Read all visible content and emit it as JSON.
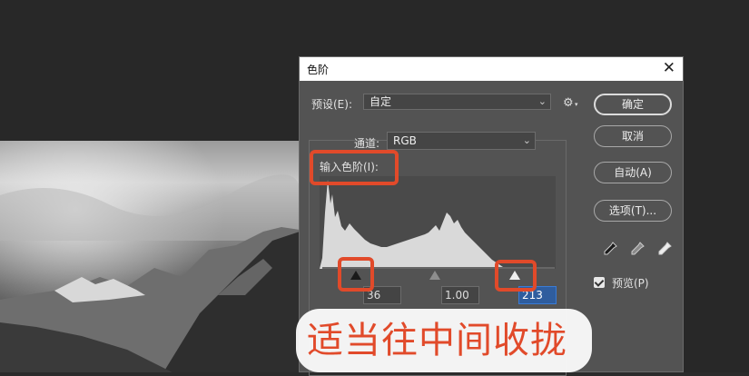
{
  "dialog": {
    "title": "色阶",
    "close_symbol": "✕",
    "preset_label": "预设(E):",
    "preset_value": "自定",
    "channel_label": "通道:",
    "channel_value": "RGB",
    "input_levels_label": "输入色阶(I):",
    "input_black": "36",
    "input_gamma": "1.00",
    "input_white": "213",
    "buttons": {
      "ok": "确定",
      "cancel": "取消",
      "auto": "自动(A)",
      "options": "选项(T)..."
    },
    "preview_label": "预览(P)",
    "preview_checked": true,
    "icons": [
      "gear-icon",
      "black-eyedropper-icon",
      "gray-eyedropper-icon",
      "white-eyedropper-icon"
    ]
  },
  "annotation": {
    "caption": "适当往中间收拢",
    "color": "#e14a2a"
  },
  "colors": {
    "dialog_bg": "#535353",
    "workspace_bg": "#282828",
    "highlight": "#e14a2a",
    "active_field": "#2f5d9e"
  }
}
